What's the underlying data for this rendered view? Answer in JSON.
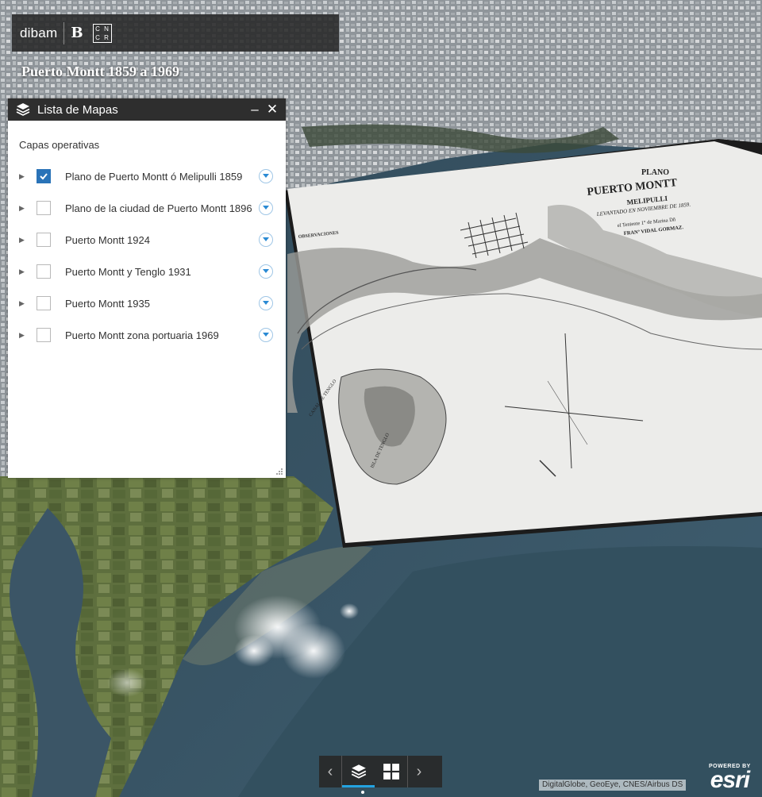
{
  "header": {
    "brand": "dibam",
    "monogram": "B",
    "cncr": [
      "C",
      "N",
      "C",
      "R"
    ],
    "title": "Puerto Montt 1859 a 1969"
  },
  "layer_panel": {
    "title": "Lista de Mapas",
    "minimize_label": "–",
    "close_label": "✕",
    "section_label": "Capas operativas",
    "layers": [
      {
        "label": "Plano de Puerto Montt ó Melipulli 1859",
        "checked": true
      },
      {
        "label": "Plano de la ciudad de Puerto Montt 1896",
        "checked": false
      },
      {
        "label": "Puerto Montt 1924",
        "checked": false
      },
      {
        "label": "Puerto Montt y Tenglo 1931",
        "checked": false
      },
      {
        "label": "Puerto Montt 1935",
        "checked": false
      },
      {
        "label": "Puerto Montt zona portuaria 1969",
        "checked": false
      }
    ]
  },
  "historic_map": {
    "title_line1": "PLANO",
    "title_line2": "PUERTO MONTT",
    "title_line3": "MELIPULLI",
    "subtitle": "LEVANTADO EN NOVIEMBRE DE 1859.",
    "author1": "el Teniente 1° de Marina Dñ",
    "author2": "FRANº VIDAL GORMAZ.",
    "observaciones": "OBSERVACIONES",
    "island_label": "ISLA DE TENGLO",
    "channel_label": "CANAL DE TENGLO"
  },
  "controller": {
    "prev_label": "‹",
    "next_label": "›"
  },
  "attribution": "DigitalGlobe, GeoEye, CNES/Airbus DS",
  "esri": {
    "top": "POWERED BY",
    "word": "esri"
  },
  "colors": {
    "accent": "#24a3e0",
    "checkbox": "#2a73b8",
    "panel_header": "#2e2e2e"
  }
}
